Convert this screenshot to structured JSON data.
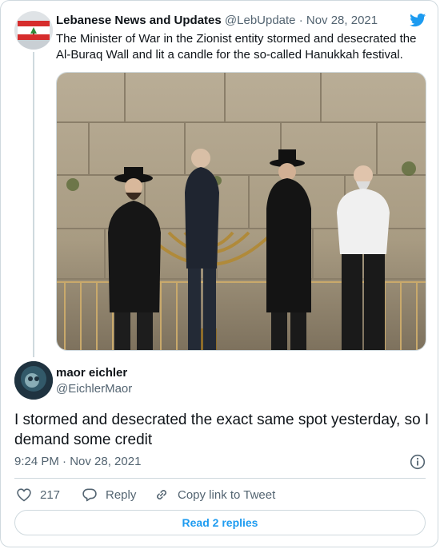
{
  "parent_tweet": {
    "display_name": "Lebanese News and Updates",
    "handle": "@LebUpdate",
    "separator": "·",
    "date": "Nov 28, 2021",
    "text": "The Minister of War in the Zionist entity stormed and desecrated the Al-Buraq Wall and lit a candle for the so-called Hanukkah festival.",
    "avatar_icon": "lebanon-flag-avatar",
    "brand_icon": "twitter-bird-icon",
    "brand_color": "#1d9bf0"
  },
  "reply_tweet": {
    "display_name": "maor eichler",
    "handle": "@EichlerMaor",
    "text": "I stormed and desecrated the exact same spot yesterday, so I demand some credit",
    "timestamp": "9:24 PM · Nov 28, 2021",
    "avatar_icon": "dark-blue-avatar"
  },
  "actions": {
    "like_count": "217",
    "reply_label": "Reply",
    "copy_link_label": "Copy link to Tweet"
  },
  "read_replies_label": "Read 2 replies",
  "colors": {
    "text": "#0f1419",
    "secondary": "#536471",
    "border": "#cfd9de",
    "accent": "#1d9bf0"
  }
}
